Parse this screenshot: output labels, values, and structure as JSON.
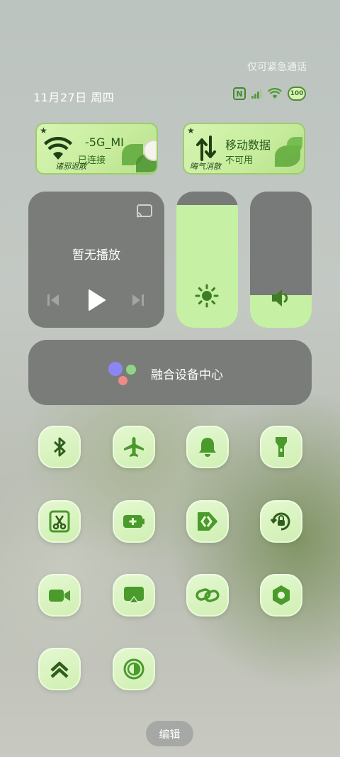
{
  "status_bar": {
    "emergency_text": "仅可紧急通话",
    "date": "11月27日 周四",
    "battery": "100",
    "nfc": "N"
  },
  "wifi_tile": {
    "name": "-5G_MI",
    "status": "已连接",
    "caption": "诸邪退散"
  },
  "data_tile": {
    "name": "移动数据",
    "status": "不可用",
    "caption": "晦气消散"
  },
  "media": {
    "title": "暂无播放"
  },
  "sliders": {
    "brightness_level": 0.9,
    "volume_level": 0.24
  },
  "fusion": {
    "label": "融合设备中心"
  },
  "quick_settings": [
    {
      "icon": "bluetooth-icon"
    },
    {
      "icon": "airplane-icon"
    },
    {
      "icon": "bell-icon"
    },
    {
      "icon": "flashlight-icon"
    },
    {
      "icon": "screenshot-icon"
    },
    {
      "icon": "battery-saver-icon"
    },
    {
      "icon": "forward-icon"
    },
    {
      "icon": "rotation-lock-icon"
    },
    {
      "icon": "video-icon"
    },
    {
      "icon": "screen-cast-icon"
    },
    {
      "icon": "link-icon"
    },
    {
      "icon": "settings-hex-icon"
    },
    {
      "icon": "chevrons-up-icon"
    },
    {
      "icon": "contrast-icon"
    }
  ],
  "edit_button": {
    "label": "编辑"
  },
  "colors": {
    "accent_green": "#3f8a2a",
    "tile_green": "#c6f0a4",
    "panel_gray": "#767876"
  }
}
